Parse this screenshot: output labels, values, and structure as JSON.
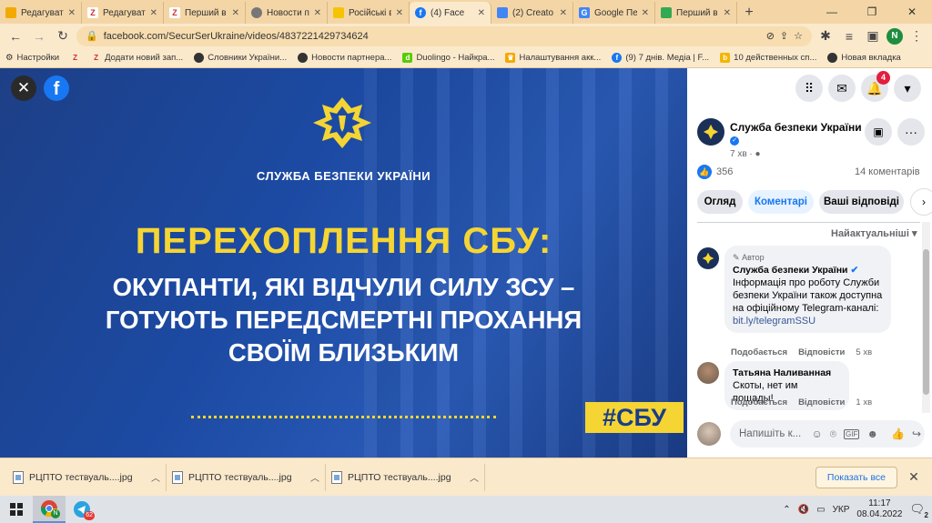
{
  "tabs": [
    {
      "label": "Редагувати",
      "icon": "bookmark-icon",
      "color": "#f2a900"
    },
    {
      "label": "Редагувати",
      "icon": "z-icon",
      "color": "#c9302c"
    },
    {
      "label": "Перший в",
      "icon": "z-icon",
      "color": "#c9302c"
    },
    {
      "label": "Новости п",
      "icon": "globe-icon",
      "color": "#666666"
    },
    {
      "label": "Російські в",
      "icon": "yellow-square-icon",
      "color": "#f5c400"
    },
    {
      "label": "(4) Face",
      "icon": "facebook-icon",
      "color": "#1877f2",
      "active": true
    },
    {
      "label": "(2) Creato",
      "icon": "creator-icon",
      "color": "#4285f4"
    },
    {
      "label": "Google Пе",
      "icon": "google-translate-icon",
      "color": "#4285f4"
    },
    {
      "label": "Перший в",
      "icon": "doc-icon",
      "color": "#34a853"
    }
  ],
  "address": {
    "url": "facebook.com/SecurSerUkraine/videos/4837221429734624",
    "profile_letter": "N"
  },
  "bookmarks": [
    {
      "label": "Настройки",
      "icon": "gear-icon"
    },
    {
      "label": "",
      "icon": "z-icon"
    },
    {
      "label": "Додати новий зап...",
      "icon": "z-icon"
    },
    {
      "label": "Словники України...",
      "icon": "globe-icon"
    },
    {
      "label": "Новости партнера...",
      "icon": "globe-icon"
    },
    {
      "label": "Duolingo - Найкра...",
      "icon": "duolingo-icon"
    },
    {
      "label": "Налаштування акк...",
      "icon": "crown-icon"
    },
    {
      "label": "(9) 7 днів. Медіа | F...",
      "icon": "facebook-icon"
    },
    {
      "label": "10 действенных сп...",
      "icon": "b-icon"
    },
    {
      "label": "Новая вкладка",
      "icon": "globe-icon"
    }
  ],
  "video": {
    "org_name": "СЛУЖБА БЕЗПЕКИ УКРАЇНИ",
    "headline": "ПЕРЕХОПЛЕННЯ СБУ:",
    "subtitle_lines": [
      "ОКУПАНТИ, ЯКІ ВІДЧУЛИ СИЛУ ЗСУ –",
      "ГОТУЮТЬ ПЕРЕДСМЕРТНІ ПРОХАННЯ",
      "СВОЇМ БЛИЗЬКИМ"
    ],
    "hashtag": "#СБУ",
    "colors": {
      "blue": "#1c4aa3",
      "yellow": "#f5d533"
    }
  },
  "header": {
    "notifications": "4"
  },
  "post": {
    "page_name": "Служба безпеки України",
    "time": "7 хв",
    "likes": "356",
    "comments_count": "14 коментарів"
  },
  "filters": [
    {
      "label": "Огляд"
    },
    {
      "label": "Коментарі",
      "active": true
    },
    {
      "label": "Ваші відповіді"
    }
  ],
  "sort_label": "Найактуальніші",
  "comments": [
    {
      "badge": "Автор",
      "name": "Служба безпеки України",
      "text": "Інформація про роботу Служби безпеки України також доступна на офіційному Telegram-каналі:",
      "link": "bit.ly/telegramSSU",
      "like": "Подобається",
      "reply": "Відповісти",
      "time": "5 хв"
    },
    {
      "name": "Татьяна Наливанная",
      "text": "Скоты, нет им пощады!",
      "like": "Подобається",
      "reply": "Відповісти",
      "time": "1 хв"
    }
  ],
  "composer": {
    "placeholder": "Напишіть к..."
  },
  "downloads": [
    {
      "name": "РЦПТО тествуаль....jpg"
    },
    {
      "name": "РЦПТО тествуаль....jpg"
    },
    {
      "name": "РЦПТО тествуаль....jpg"
    }
  ],
  "show_all": "Показать все",
  "taskbar": {
    "chrome_badge": "N",
    "telegram_badge": "62",
    "lang": "УКР",
    "time": "11:17",
    "date": "08.04.2022",
    "notif_count": "2"
  }
}
